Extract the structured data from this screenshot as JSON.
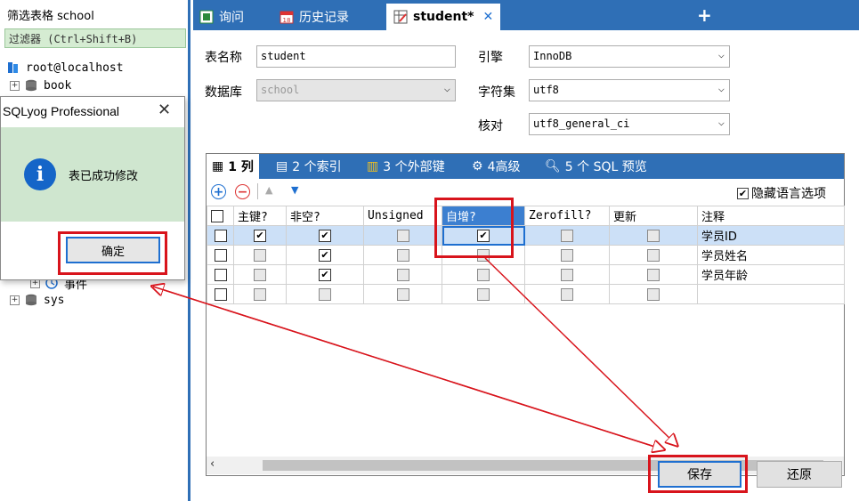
{
  "left": {
    "filter_label": "筛选表格 school",
    "filter_placeholder": "过滤器 (Ctrl+Shift+B)",
    "tree": {
      "connection": "root@localhost",
      "db_book": "book",
      "events": "事件",
      "db_sys": "sys"
    }
  },
  "dialog": {
    "title": "SQLyog Professional",
    "close": "✕",
    "message": "表已成功修改",
    "ok": "确定"
  },
  "tabs": {
    "query": "询问",
    "history": "历史记录",
    "active": "student*",
    "close": "✕",
    "add": "+"
  },
  "form": {
    "table_name_label": "表名称",
    "table_name": "student",
    "database_label": "数据库",
    "database": "school",
    "engine_label": "引擎",
    "engine": "InnoDB",
    "charset_label": "字符集",
    "charset": "utf8",
    "collation_label": "核对",
    "collation": "utf8_general_ci"
  },
  "subtabs": {
    "columns": "1 列",
    "indexes": "2 个索引",
    "foreign_keys": "3 个外部键",
    "advanced": "4高级",
    "sql_preview": "5 个 SQL 预览"
  },
  "toolbar": {
    "hide_lang": "隐藏语言选项"
  },
  "grid": {
    "headers": [
      "主键?",
      "非空?",
      "Unsigned",
      "自增?",
      "Zerofill?",
      "更新",
      "注释"
    ],
    "rows": [
      {
        "comment": "学员ID"
      },
      {
        "comment": "学员姓名"
      },
      {
        "comment": "学员年龄"
      },
      {
        "comment": ""
      }
    ]
  },
  "buttons": {
    "save": "保存",
    "revert": "还原"
  },
  "colors": {
    "accent": "#2f6fb6",
    "highlight": "#d8141c"
  }
}
